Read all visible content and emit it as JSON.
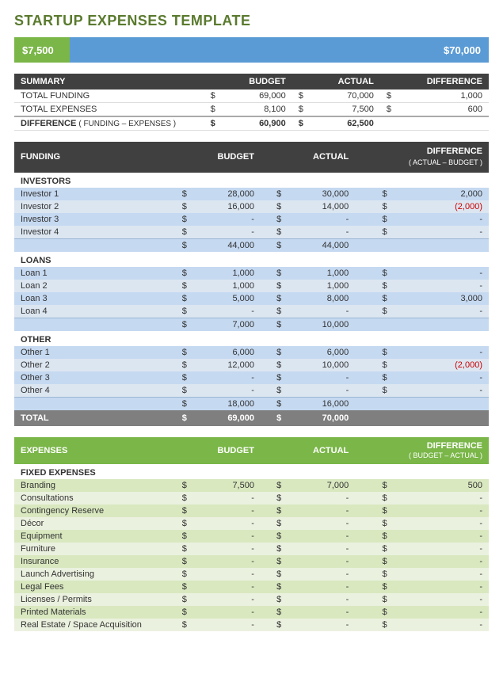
{
  "title": "STARTUP EXPENSES TEMPLATE",
  "progressBar": {
    "leftValue": "$7,500",
    "rightValue": "$70,000",
    "leftWidthPercent": 10
  },
  "summary": {
    "headers": [
      "SUMMARY",
      "BUDGET",
      "",
      "ACTUAL",
      "",
      "DIFFERENCE"
    ],
    "rows": [
      {
        "label": "TOTAL FUNDING",
        "budgetDollar": "$",
        "budget": "69,000",
        "actualDollar": "$",
        "actual": "70,000",
        "diffDollar": "$",
        "diff": "1,000",
        "red": false
      },
      {
        "label": "TOTAL EXPENSES",
        "budgetDollar": "$",
        "budget": "8,100",
        "actualDollar": "$",
        "actual": "7,500",
        "diffDollar": "$",
        "diff": "600",
        "red": false
      }
    ],
    "diffRow": {
      "label": "DIFFERENCE",
      "sublabel": "( FUNDING – EXPENSES )",
      "budgetDollar": "$",
      "budget": "60,900",
      "actualDollar": "$",
      "actual": "62,500"
    }
  },
  "funding": {
    "headers": [
      "FUNDING",
      "BUDGET",
      "ACTUAL",
      "DIFFERENCE\n( ACTUAL – BUDGET )"
    ],
    "groups": [
      {
        "label": "INVESTORS",
        "rows": [
          {
            "label": "Investor 1",
            "budgetDollar": "$",
            "budget": "28,000",
            "actualDollar": "$",
            "actual": "30,000",
            "diffDollar": "$",
            "diff": "2,000",
            "red": false
          },
          {
            "label": "Investor 2",
            "budgetDollar": "$",
            "budget": "16,000",
            "actualDollar": "$",
            "actual": "14,000",
            "diffDollar": "$",
            "diff": "(2,000)",
            "red": true
          },
          {
            "label": "Investor 3",
            "budgetDollar": "$",
            "budget": "-",
            "actualDollar": "$",
            "actual": "-",
            "diffDollar": "$",
            "diff": "-",
            "red": false
          },
          {
            "label": "Investor 4",
            "budgetDollar": "$",
            "budget": "-",
            "actualDollar": "$",
            "actual": "-",
            "diffDollar": "$",
            "diff": "-",
            "red": false
          }
        ],
        "subtotal": {
          "budgetDollar": "$",
          "budget": "44,000",
          "actualDollar": "$",
          "actual": "44,000"
        }
      },
      {
        "label": "LOANS",
        "rows": [
          {
            "label": "Loan 1",
            "budgetDollar": "$",
            "budget": "1,000",
            "actualDollar": "$",
            "actual": "1,000",
            "diffDollar": "$",
            "diff": "-",
            "red": false
          },
          {
            "label": "Loan 2",
            "budgetDollar": "$",
            "budget": "1,000",
            "actualDollar": "$",
            "actual": "1,000",
            "diffDollar": "$",
            "diff": "-",
            "red": false
          },
          {
            "label": "Loan 3",
            "budgetDollar": "$",
            "budget": "5,000",
            "actualDollar": "$",
            "actual": "8,000",
            "diffDollar": "$",
            "diff": "3,000",
            "red": false
          },
          {
            "label": "Loan 4",
            "budgetDollar": "$",
            "budget": "-",
            "actualDollar": "$",
            "actual": "-",
            "diffDollar": "$",
            "diff": "-",
            "red": false
          }
        ],
        "subtotal": {
          "budgetDollar": "$",
          "budget": "7,000",
          "actualDollar": "$",
          "actual": "10,000"
        }
      },
      {
        "label": "OTHER",
        "rows": [
          {
            "label": "Other 1",
            "budgetDollar": "$",
            "budget": "6,000",
            "actualDollar": "$",
            "actual": "6,000",
            "diffDollar": "$",
            "diff": "-",
            "red": false
          },
          {
            "label": "Other 2",
            "budgetDollar": "$",
            "budget": "12,000",
            "actualDollar": "$",
            "actual": "10,000",
            "diffDollar": "$",
            "diff": "(2,000)",
            "red": true
          },
          {
            "label": "Other 3",
            "budgetDollar": "$",
            "budget": "-",
            "actualDollar": "$",
            "actual": "-",
            "diffDollar": "$",
            "diff": "-",
            "red": false
          },
          {
            "label": "Other 4",
            "budgetDollar": "$",
            "budget": "-",
            "actualDollar": "$",
            "actual": "-",
            "diffDollar": "$",
            "diff": "-",
            "red": false
          }
        ],
        "subtotal": {
          "budgetDollar": "$",
          "budget": "18,000",
          "actualDollar": "$",
          "actual": "16,000"
        }
      }
    ],
    "total": {
      "label": "TOTAL",
      "budgetDollar": "$",
      "budget": "69,000",
      "actualDollar": "$",
      "actual": "70,000"
    }
  },
  "expenses": {
    "headers": [
      "EXPENSES",
      "BUDGET",
      "ACTUAL",
      "DIFFERENCE\n( BUDGET – ACTUAL )"
    ],
    "groups": [
      {
        "label": "FIXED EXPENSES",
        "rows": [
          {
            "label": "Branding",
            "budgetDollar": "$",
            "budget": "7,500",
            "actualDollar": "$",
            "actual": "7,000",
            "diffDollar": "$",
            "diff": "500",
            "red": false
          },
          {
            "label": "Consultations",
            "budgetDollar": "$",
            "budget": "-",
            "actualDollar": "$",
            "actual": "-",
            "diffDollar": "$",
            "diff": "-",
            "red": false
          },
          {
            "label": "Contingency Reserve",
            "budgetDollar": "$",
            "budget": "-",
            "actualDollar": "$",
            "actual": "-",
            "diffDollar": "$",
            "diff": "-",
            "red": false
          },
          {
            "label": "Décor",
            "budgetDollar": "$",
            "budget": "-",
            "actualDollar": "$",
            "actual": "-",
            "diffDollar": "$",
            "diff": "-",
            "red": false
          },
          {
            "label": "Equipment",
            "budgetDollar": "$",
            "budget": "-",
            "actualDollar": "$",
            "actual": "-",
            "diffDollar": "$",
            "diff": "-",
            "red": false
          },
          {
            "label": "Furniture",
            "budgetDollar": "$",
            "budget": "-",
            "actualDollar": "$",
            "actual": "-",
            "diffDollar": "$",
            "diff": "-",
            "red": false
          },
          {
            "label": "Insurance",
            "budgetDollar": "$",
            "budget": "-",
            "actualDollar": "$",
            "actual": "-",
            "diffDollar": "$",
            "diff": "-",
            "red": false
          },
          {
            "label": "Launch Advertising",
            "budgetDollar": "$",
            "budget": "-",
            "actualDollar": "$",
            "actual": "-",
            "diffDollar": "$",
            "diff": "-",
            "red": false
          },
          {
            "label": "Legal Fees",
            "budgetDollar": "$",
            "budget": "-",
            "actualDollar": "$",
            "actual": "-",
            "diffDollar": "$",
            "diff": "-",
            "red": false
          },
          {
            "label": "Licenses / Permits",
            "budgetDollar": "$",
            "budget": "-",
            "actualDollar": "$",
            "actual": "-",
            "diffDollar": "$",
            "diff": "-",
            "red": false
          },
          {
            "label": "Printed Materials",
            "budgetDollar": "$",
            "budget": "-",
            "actualDollar": "$",
            "actual": "-",
            "diffDollar": "$",
            "diff": "-",
            "red": false
          },
          {
            "label": "Real Estate / Space Acquisition",
            "budgetDollar": "$",
            "budget": "-",
            "actualDollar": "$",
            "actual": "-",
            "diffDollar": "$",
            "diff": "-",
            "red": false
          }
        ]
      }
    ]
  }
}
